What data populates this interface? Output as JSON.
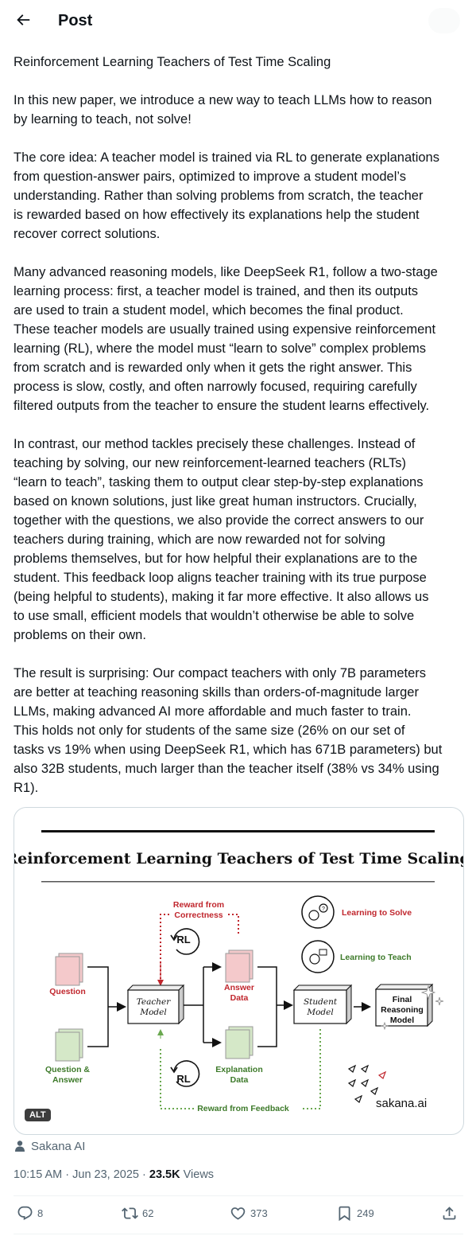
{
  "header": {
    "title": "Post"
  },
  "post": {
    "text": "Reinforcement Learning Teachers of Test Time Scaling\n\nIn this new paper, we introduce a new way to teach LLMs how to reason\nby learning to teach, not solve!\n\nThe core idea: A teacher model is trained via RL to generate explanations\nfrom question-answer pairs, optimized to improve a student model’s\nunderstanding. Rather than solving problems from scratch, the teacher\nis rewarded based on how effectively its explanations help the student\nrecover correct solutions.\n\nMany advanced reasoning models, like DeepSeek R1, follow a two-stage\nlearning process: first, a teacher model is trained, and then its outputs\nare used to train a student model, which becomes the final product.\nThese teacher models are usually trained using expensive reinforcement\nlearning (RL), where the model must “learn to solve” complex problems\nfrom scratch and is rewarded only when it gets the right answer. This\nprocess is slow, costly, and often narrowly focused, requiring carefully\nfiltered outputs from the teacher to ensure the student learns effectively.\n\nIn contrast, our method tackles precisely these challenges. Instead of\nteaching by solving, our new reinforcement-learned teachers (RLTs)\n“learn to teach”, tasking them to output clear step-by-step explanations\nbased on known solutions, just like great human instructors. Crucially,\ntogether with the questions, we also provide the correct answers to our\nteachers during training, which are now rewarded not for solving\nproblems themselves, but for how helpful their explanations are to the\nstudent. This feedback loop aligns teacher training with its true purpose\n(being helpful to students), making it far more effective. It also allows us\nto use small, efficient models that wouldn’t otherwise be able to solve\nproblems on their own.\n\nThe result is surprising: Our compact teachers with only 7B parameters\nare better at teaching reasoning skills than orders-of-magnitude larger\nLLMs, making advanced AI more affordable and much faster to train.\nThis holds not only for students of the same size (26% on our set of\ntasks vs 19% when using DeepSeek R1, which has 671B parameters) but\nalso 32B students, much larger than the teacher itself (38% vs 34% using\nR1).",
    "author": "Sakana AI",
    "time": "10:15 AM · Jun 23, 2025 · ",
    "views_count": "23.5K",
    "views_label": " Views"
  },
  "figure": {
    "title": "Reinforcement Learning Teachers of Test Time Scaling",
    "reward_correctness_1": "Reward from",
    "reward_correctness_2": "Correctness",
    "rl": "RL",
    "learning_to_solve": "Learning to Solve",
    "learning_to_teach": "Learning to Teach",
    "question": "Question",
    "question_answer_1": "Question &",
    "question_answer_2": "Answer",
    "teacher_1": "Teacher",
    "teacher_2": "Model",
    "answer_data_1": "Answer",
    "answer_data_2": "Data",
    "explanation_data_1": "Explanation",
    "explanation_data_2": "Data",
    "student_1": "Student",
    "student_2": "Model",
    "final_1": "Final",
    "final_2": "Reasoning",
    "final_3": "Model",
    "reward_feedback": "Reward from Feedback",
    "brand": "sakana.ai",
    "alt": "ALT",
    "colors": {
      "red": "#c0262d",
      "green": "#3d7a2a",
      "red_doc": "#f4c9cb",
      "green_doc": "#d5e8c8"
    }
  },
  "actions": {
    "replies": "8",
    "reposts": "62",
    "likes": "373",
    "bookmarks": "249"
  }
}
